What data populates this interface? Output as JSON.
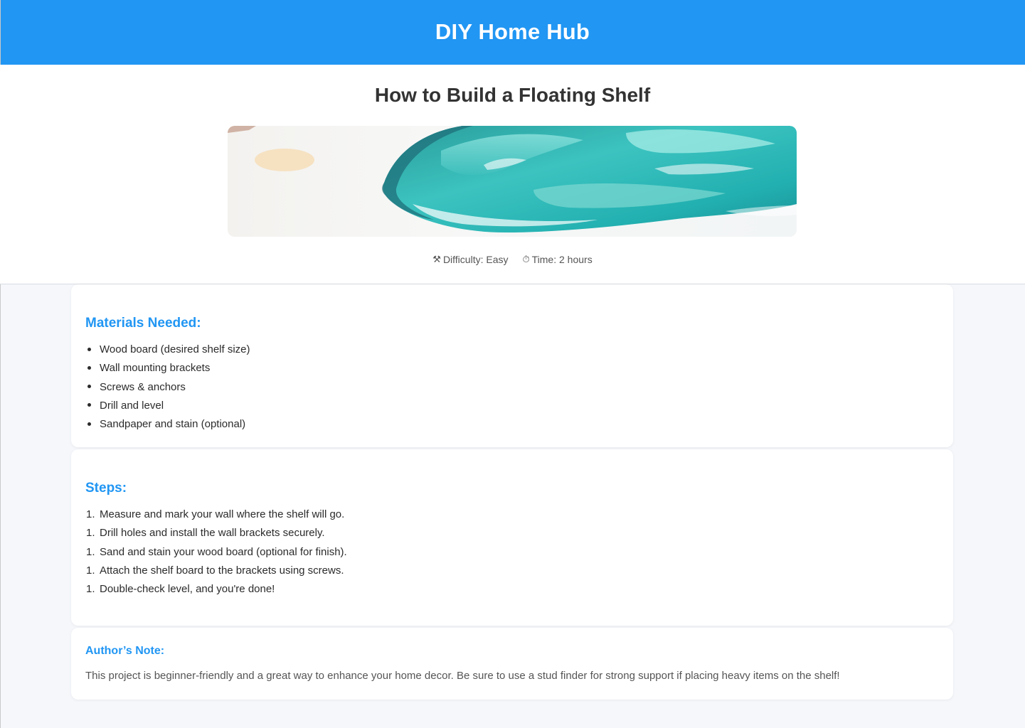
{
  "header": {
    "site_title": "DIY Home Hub",
    "background_color": "#2196f3"
  },
  "article": {
    "title": "How to Build a Floating Shelf",
    "hero_image": {
      "description_icon": "paint-swatch-image"
    },
    "meta": {
      "difficulty_icon": "tools-icon",
      "difficulty": "Difficulty: Easy",
      "time_icon": "stopwatch-icon",
      "time": "Time: 2 hours"
    }
  },
  "materials": {
    "heading": "Materials Needed:",
    "items": [
      "Wood board (desired shelf size)",
      "Wall mounting brackets",
      "Screws & anchors",
      "Drill and level",
      "Sandpaper and stain (optional)"
    ]
  },
  "steps": {
    "heading": "Steps:",
    "number_label": "1.",
    "items": [
      "Measure and mark your wall where the shelf will go.",
      "Drill holes and install the wall brackets securely.",
      "Sand and stain your wood board (optional for finish).",
      "Attach the shelf board to the brackets using screws.",
      "Double-check level, and you're done!"
    ]
  },
  "note": {
    "heading": "Author’s Note:",
    "text": "This project is beginner-friendly and a great way to enhance your home decor. Be sure to use a stud finder for strong support if placing heavy items on the shelf!"
  },
  "colors": {
    "accent": "#2196f3",
    "page_background": "#f5f7fb",
    "card_background": "#ffffff"
  }
}
